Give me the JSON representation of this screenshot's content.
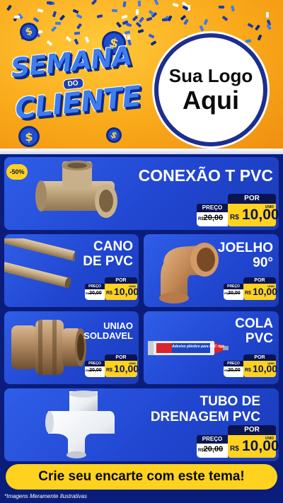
{
  "header": {
    "title_line1": "SEMANA",
    "title_line2": "DO",
    "title_line3": "CLIENTE",
    "logo_line1": "Sua Logo",
    "logo_line2": "Aqui",
    "coin_symbol": "$"
  },
  "colors": {
    "accent_yellow": "#ffd21f",
    "card_blue": "#2f5ee8",
    "navy": "#0a1450",
    "header_orange": "#f9a91a"
  },
  "products": [
    {
      "name_line1": "CONEXÃO T PVC",
      "name_line2": "",
      "icon": "pvc-tee-fitting-icon",
      "price_label": "PREÇO",
      "old_price": "20,00",
      "old_prefix": "R$",
      "por_label": "POR",
      "currency": "R$",
      "new_price": "10,00",
      "unit": "UNID"
    },
    {
      "name_line1": "CANO",
      "name_line2": "DE PVC",
      "icon": "pvc-pipe-icon",
      "price_label": "PREÇO",
      "old_price": "20,00",
      "old_prefix": "R$",
      "por_label": "POR",
      "currency": "R$",
      "new_price": "10,00",
      "unit": "UNID"
    },
    {
      "name_line1": "JOELHO",
      "name_line2": "90°",
      "icon": "pvc-elbow-icon",
      "price_label": "PREÇO",
      "old_price": "20,00",
      "old_prefix": "R$",
      "por_label": "POR",
      "currency": "R$",
      "new_price": "10,00",
      "unit": "UNID"
    },
    {
      "name_line1": "UNIAO",
      "name_line2": "SOLDAVEL",
      "icon": "pvc-union-icon",
      "price_label": "PREÇO",
      "old_price": "20,00",
      "old_prefix": "R$",
      "por_label": "POR",
      "currency": "R$",
      "new_price": "10,00",
      "unit": "UNID"
    },
    {
      "name_line1": "COLA",
      "name_line2": "PVC",
      "icon": "pvc-glue-tube-icon",
      "price_label": "PREÇO",
      "old_price": "20,00",
      "old_prefix": "R$",
      "por_label": "POR",
      "currency": "R$",
      "new_price": "10,00",
      "unit": "UNID",
      "product_label": "Adesivo plástico para PVC rígido"
    },
    {
      "name_line1": "TUBO DE",
      "name_line2": "DRENAGEM PVC",
      "icon": "drain-tee-icon",
      "price_label": "PREÇO",
      "old_price": "20,00",
      "old_prefix": "R$",
      "por_label": "POR",
      "currency": "R$",
      "new_price": "10,00",
      "unit": "UNID"
    }
  ],
  "discount_badge": "-50%",
  "cta": "Crie seu encarte com este tema!",
  "footnote": "*Imagens Meramente Ilustrativas"
}
